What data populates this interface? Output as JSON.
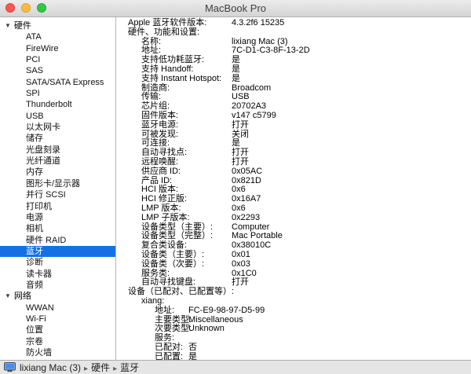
{
  "window": {
    "title": "MacBook Pro"
  },
  "colors": {
    "selection_blue": "#1571e3",
    "titlebar_top": "#ececec",
    "titlebar_bottom": "#d4d4d4"
  },
  "sidebar": {
    "sections": [
      {
        "header": "硬件",
        "items": [
          "ATA",
          "FireWire",
          "PCI",
          "SAS",
          "SATA/SATA Express",
          "SPI",
          "Thunderbolt",
          "USB",
          "以太网卡",
          "储存",
          "光盘刻录",
          "光纤通道",
          "内存",
          "图形卡/显示器",
          "并行 SCSI",
          "打印机",
          "电源",
          "相机",
          "硬件 RAID",
          "蓝牙",
          "诊断",
          "读卡器",
          "音频"
        ]
      },
      {
        "header": "网络",
        "items": [
          "WWAN",
          "Wi-Fi",
          "位置",
          "宗卷",
          "防火墙"
        ]
      }
    ],
    "selected": "蓝牙"
  },
  "content": {
    "rows": [
      {
        "label": "Apple 蓝牙软件版本:",
        "value": "4.3.2f6 15235",
        "depth": 0
      },
      {
        "label": "硬件、功能和设置:",
        "value": "",
        "depth": 0
      },
      {
        "label": "名称:",
        "value": "lixiang Mac (3)",
        "depth": 1
      },
      {
        "label": "地址:",
        "value": "7C-D1-C3-8F-13-2D",
        "depth": 1
      },
      {
        "label": "支持低功耗蓝牙:",
        "value": "是",
        "depth": 1
      },
      {
        "label": "支持 Handoff:",
        "value": "是",
        "depth": 1
      },
      {
        "label": "支持 Instant Hotspot:",
        "value": "是",
        "depth": 1
      },
      {
        "label": "制造商:",
        "value": "Broadcom",
        "depth": 1
      },
      {
        "label": "传输:",
        "value": "USB",
        "depth": 1
      },
      {
        "label": "芯片组:",
        "value": "20702A3",
        "depth": 1
      },
      {
        "label": "固件版本:",
        "value": "v147 c5799",
        "depth": 1
      },
      {
        "label": "蓝牙电源:",
        "value": "打开",
        "depth": 1
      },
      {
        "label": "可被发现:",
        "value": "关闭",
        "depth": 1
      },
      {
        "label": "可连接:",
        "value": "是",
        "depth": 1
      },
      {
        "label": "自动寻找点:",
        "value": "打开",
        "depth": 1
      },
      {
        "label": "远程唤醒:",
        "value": "打开",
        "depth": 1
      },
      {
        "label": "供应商 ID:",
        "value": "0x05AC",
        "depth": 1
      },
      {
        "label": "产品 ID:",
        "value": "0x821D",
        "depth": 1
      },
      {
        "label": "HCI 版本:",
        "value": "0x6",
        "depth": 1
      },
      {
        "label": "HCI 修正版:",
        "value": "0x16A7",
        "depth": 1
      },
      {
        "label": "LMP 版本:",
        "value": "0x6",
        "depth": 1
      },
      {
        "label": "LMP 子版本:",
        "value": "0x2293",
        "depth": 1
      },
      {
        "label": "设备类型（主要）:",
        "value": "Computer",
        "depth": 1
      },
      {
        "label": "设备类型（完整）:",
        "value": "Mac Portable",
        "depth": 1
      },
      {
        "label": "复合类设备:",
        "value": "0x38010C",
        "depth": 1
      },
      {
        "label": "设备类（主要）:",
        "value": "0x01",
        "depth": 1
      },
      {
        "label": "设备类（次要）:",
        "value": "0x03",
        "depth": 1
      },
      {
        "label": "服务类:",
        "value": "0x1C0",
        "depth": 1
      },
      {
        "label": "自动寻找键盘:",
        "value": "打开",
        "depth": 1
      },
      {
        "label": "设备（已配对、已配置等）:",
        "value": "",
        "depth": 0
      },
      {
        "label": "xiang:",
        "value": "",
        "depth": 1
      },
      {
        "label": "地址:",
        "value": "FC-E9-98-97-D5-99",
        "depth": 2
      },
      {
        "label": "主要类型:",
        "value": "Miscellaneous",
        "depth": 2
      },
      {
        "label": "次要类型:",
        "value": "Unknown",
        "depth": 2
      },
      {
        "label": "服务:",
        "value": "",
        "depth": 2
      },
      {
        "label": "已配对:",
        "value": "否",
        "depth": 2
      },
      {
        "label": "已配置:",
        "value": "是",
        "depth": 2
      }
    ]
  },
  "statusbar": {
    "icon": "computer-icon",
    "crumbs": [
      "lixiang Mac (3)",
      "硬件",
      "蓝牙"
    ],
    "separator": "▸"
  }
}
